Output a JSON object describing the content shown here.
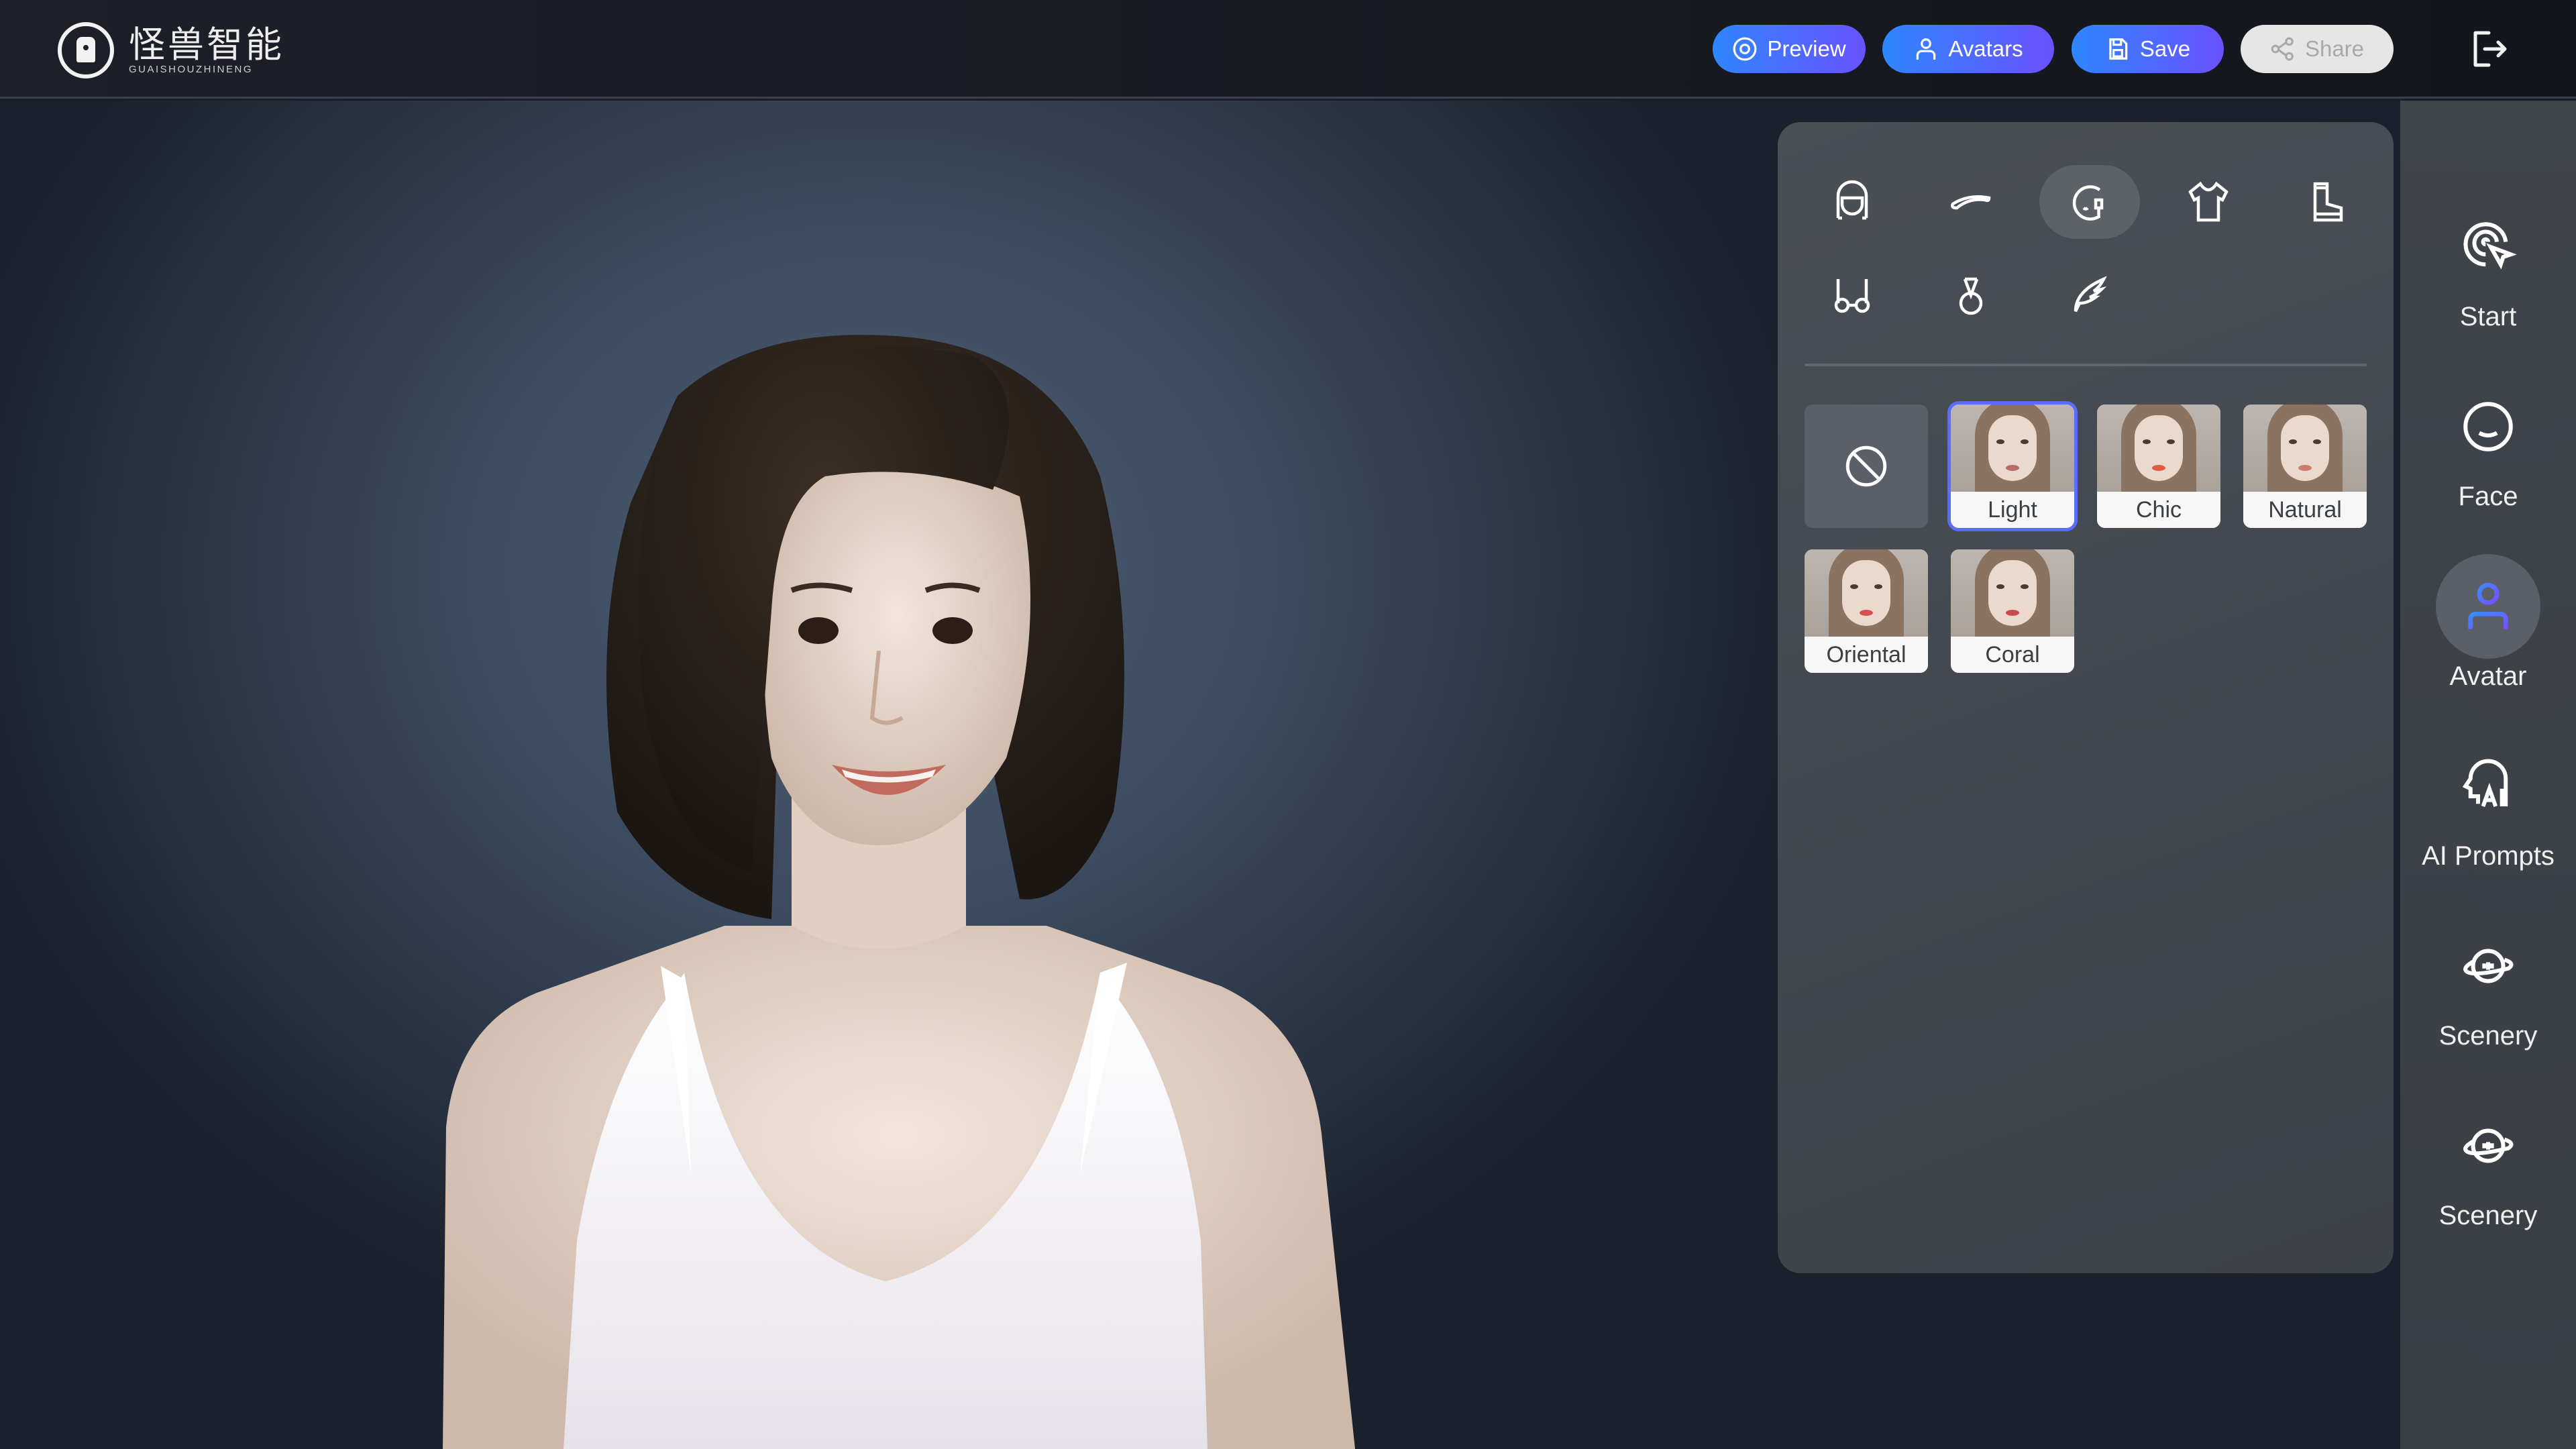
{
  "header": {
    "logo_cn": "怪兽智能",
    "logo_en": "GUAISHOUZHINENG",
    "buttons": {
      "preview": "Preview",
      "avatars": "Avatars",
      "save": "Save",
      "share": "Share"
    },
    "exit_icon": "exit-icon"
  },
  "panel": {
    "categories": [
      {
        "name": "hair",
        "icon": "hair-icon",
        "active": false
      },
      {
        "name": "eyebrows",
        "icon": "eyebrow-icon",
        "active": false
      },
      {
        "name": "makeup",
        "icon": "makeup-icon",
        "active": true
      },
      {
        "name": "top",
        "icon": "tshirt-icon",
        "active": false
      },
      {
        "name": "shoes",
        "icon": "boot-icon",
        "active": false
      },
      {
        "name": "glasses",
        "icon": "glasses-icon",
        "active": false
      },
      {
        "name": "necklace",
        "icon": "necklace-icon",
        "active": false
      },
      {
        "name": "wings",
        "icon": "wing-icon",
        "active": false
      }
    ],
    "options": [
      {
        "label": "",
        "type": "none",
        "icon": "none-icon"
      },
      {
        "label": "Light",
        "selected": true,
        "lip": "#b86a6a"
      },
      {
        "label": "Chic",
        "selected": false,
        "lip": "#e05a45"
      },
      {
        "label": "Natural",
        "selected": false,
        "lip": "#cf7b72"
      },
      {
        "label": "Oriental",
        "selected": false,
        "lip": "#d6504e"
      },
      {
        "label": "Coral",
        "selected": false,
        "lip": "#c9484a"
      }
    ]
  },
  "sidebar": {
    "items": [
      {
        "label": "Start",
        "icon": "touch-icon",
        "active": false
      },
      {
        "label": "Face",
        "icon": "face-icon",
        "active": false
      },
      {
        "label": "Avatar",
        "icon": "user-icon",
        "active": true
      },
      {
        "label": "AI Prompts",
        "icon": "ai-head-icon",
        "active": false
      },
      {
        "label": "Scenery",
        "icon": "planet-icon",
        "active": false
      },
      {
        "label": "Scenery",
        "icon": "planet-icon",
        "active": false
      }
    ]
  },
  "colors": {
    "accent_start": "#2f86ff",
    "accent_end": "#6a52ff",
    "active_icon": "#5b6cff"
  }
}
